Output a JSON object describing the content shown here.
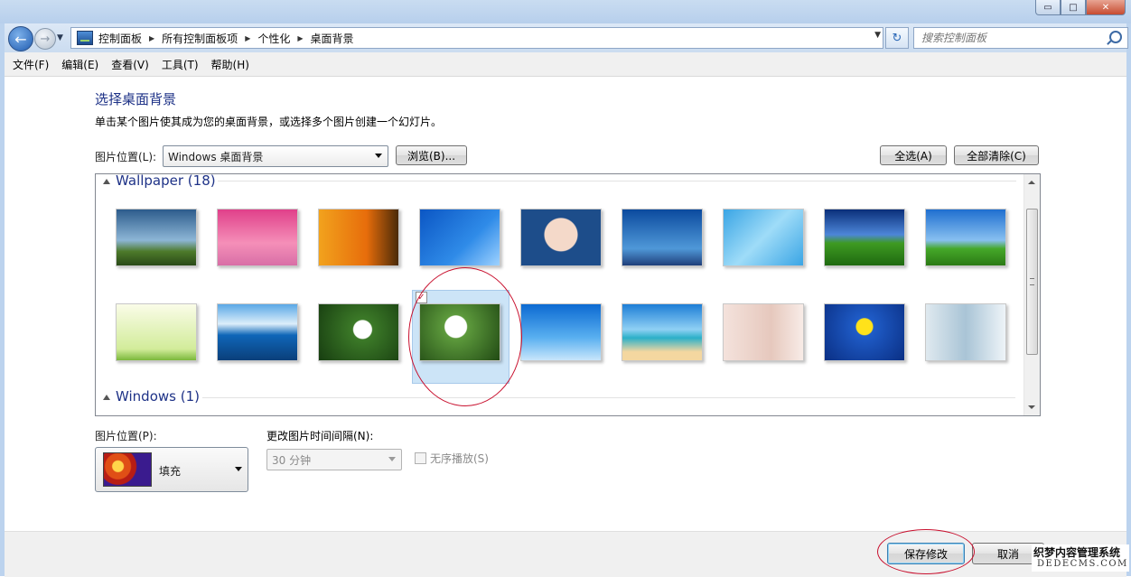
{
  "window": {
    "controls": {
      "minimize": "▭",
      "maximize": "□",
      "close": "✕"
    }
  },
  "address_bar": {
    "breadcrumbs": [
      "控制面板",
      "所有控制面板项",
      "个性化",
      "桌面背景"
    ],
    "search_placeholder": "搜索控制面板"
  },
  "menu": [
    "文件(F)",
    "编辑(E)",
    "查看(V)",
    "工具(T)",
    "帮助(H)"
  ],
  "page": {
    "title": "选择桌面背景",
    "description": "单击某个图片使其成为您的桌面背景，或选择多个图片创建一个幻灯片。",
    "location_label": "图片位置(L):",
    "location_value": "Windows 桌面背景",
    "browse_button": "浏览(B)...",
    "select_all_button": "全选(A)",
    "clear_all_button": "全部清除(C)"
  },
  "gallery": {
    "groups": [
      {
        "label": "Wallpaper (18)"
      },
      {
        "label": "Windows (1)"
      }
    ],
    "selected_index": 12,
    "thumbnails": [
      "tree-on-hill",
      "pink-palm-sunset",
      "orange-bird-silhouette",
      "blue-swirl",
      "cartoon-heart",
      "blue-sky-tree",
      "blue-squares",
      "green-field",
      "green-grass",
      "green-hearts",
      "ocean-bottle",
      "white-flowers",
      "white-flower-closeup",
      "wind-turbine",
      "tropical-beach",
      "woman-legs",
      "dandelion",
      "winter-girl"
    ]
  },
  "bottom": {
    "position_label": "图片位置(P):",
    "position_value": "填充",
    "interval_label": "更改图片时间间隔(N):",
    "interval_value": "30 分钟",
    "shuffle_label": "无序播放(S)"
  },
  "footer": {
    "save_button": "保存修改",
    "cancel_button": "取消"
  },
  "watermark": {
    "line1": "织梦内容管理系统",
    "line2": "DEDECMS.COM"
  },
  "colors": {
    "title_blue": "#1e3287",
    "selection": "#cce4f7",
    "annotation_red": "#c8102e"
  }
}
